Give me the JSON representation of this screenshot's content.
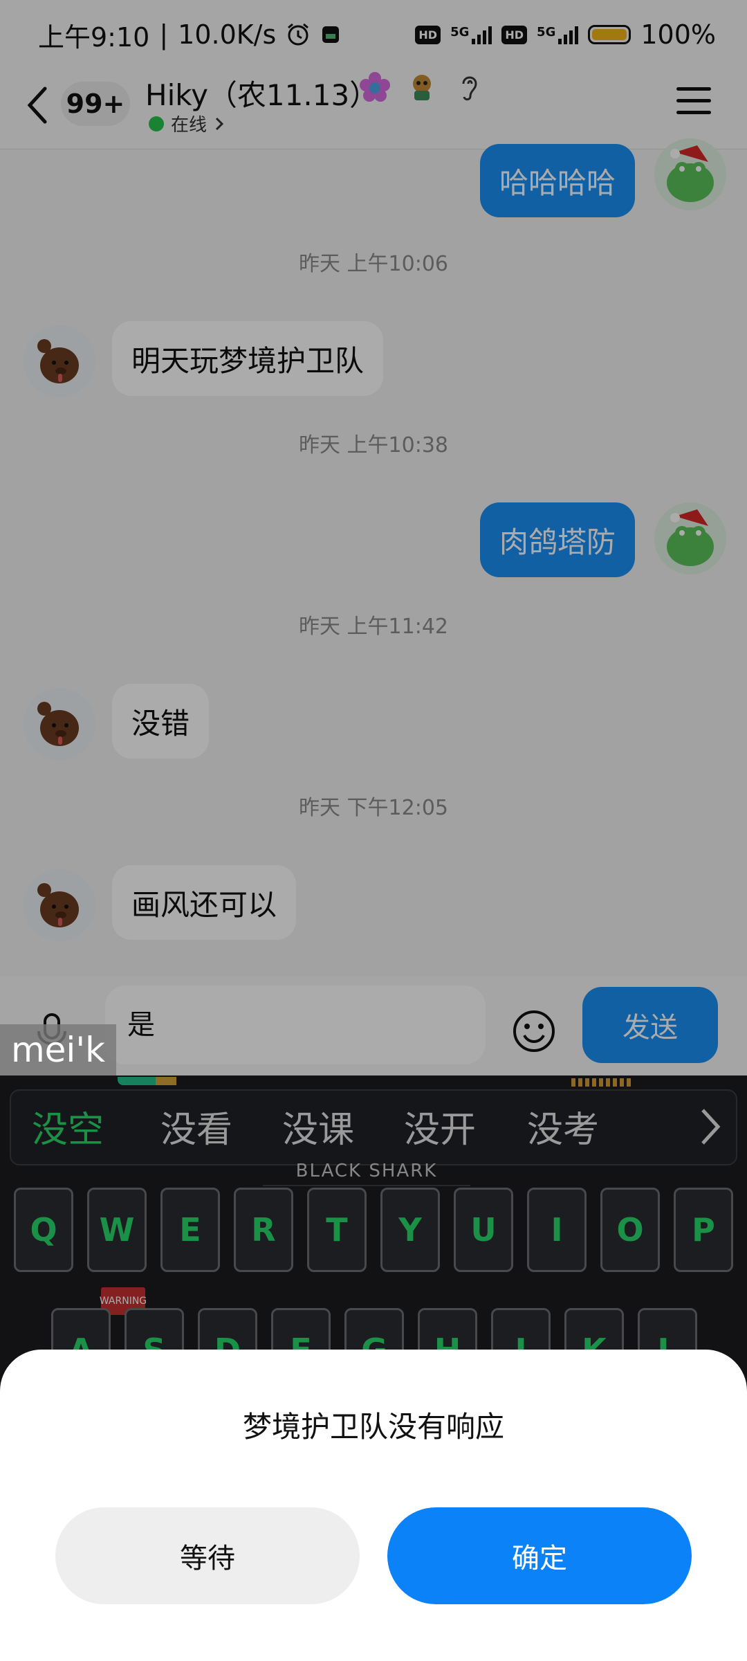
{
  "status_bar": {
    "time": "上午9:10",
    "network_speed": "10.0K/s",
    "battery": "100%",
    "hd1": "HD",
    "hd2": "HD",
    "net1": "5G",
    "net2": "5G",
    "icons": [
      "alarm-icon",
      "app-icon",
      "signal-icon",
      "battery-icon"
    ]
  },
  "header": {
    "unread": "99+",
    "name": "Hiky（农11.13）",
    "status": "在线",
    "icons": [
      "flower-icon",
      "cartoon-badge-icon",
      "ear-icon",
      "menu-icon"
    ]
  },
  "messages": [
    {
      "type": "out",
      "text": "哈哈哈哈"
    },
    {
      "type": "time",
      "text": "昨天 上午10:06"
    },
    {
      "type": "in",
      "text": "明天玩梦境护卫队"
    },
    {
      "type": "time",
      "text": "昨天 上午10:38"
    },
    {
      "type": "out",
      "text": "肉鸽塔防"
    },
    {
      "type": "time",
      "text": "昨天 上午11:42"
    },
    {
      "type": "in",
      "text": "没错"
    },
    {
      "type": "time",
      "text": "昨天 下午12:05"
    },
    {
      "type": "in",
      "text": "画风还可以"
    }
  ],
  "input": {
    "value": "是",
    "send_label": "发送"
  },
  "watermark": "mei'k",
  "keyboard": {
    "candidates": [
      "没空",
      "没看",
      "没课",
      "没开",
      "没考"
    ],
    "brand": "BLACK SHARK",
    "row1": [
      "Q",
      "W",
      "E",
      "R",
      "T",
      "Y",
      "U",
      "I",
      "O",
      "P"
    ],
    "row2": [
      "A",
      "S",
      "D",
      "F",
      "G",
      "H",
      "J",
      "K",
      "L"
    ],
    "warning_tag": "WARNING",
    "key_color": "#27d86a"
  },
  "dialog": {
    "title": "梦境护卫队没有响应",
    "wait_label": "等待",
    "ok_label": "确定"
  },
  "colors": {
    "accent": "#1b8ff5",
    "online": "#27c24c"
  }
}
